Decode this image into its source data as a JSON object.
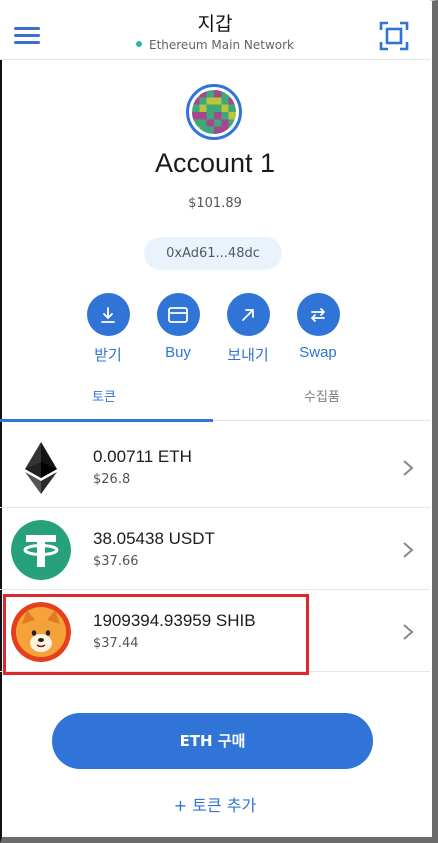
{
  "header": {
    "title": "지갑",
    "network": "Ethereum Main Network"
  },
  "account": {
    "name": "Account 1",
    "balance": "$101.89",
    "address": "0xAd61...48dc"
  },
  "actions": [
    {
      "label": "받기",
      "icon": "download-icon"
    },
    {
      "label": "Buy",
      "icon": "card-icon"
    },
    {
      "label": "보내기",
      "icon": "arrow-up-right-icon"
    },
    {
      "label": "Swap",
      "icon": "swap-icon"
    }
  ],
  "tabs": {
    "tokens": "토큰",
    "collectibles": "수집품"
  },
  "tokens": [
    {
      "amount": "0.00711 ETH",
      "fiat": "$26.8",
      "icon": "ethereum-icon"
    },
    {
      "amount": "38.05438 USDT",
      "fiat": "$37.66",
      "icon": "tether-icon"
    },
    {
      "amount": "1909394.93959 SHIB",
      "fiat": "$37.44",
      "icon": "shiba-inu-icon"
    }
  ],
  "buttons": {
    "buy_eth": "ETH 구매",
    "add_token": "+ 토큰 추가"
  },
  "colors": {
    "accent": "#2f74d6",
    "network_dot": "#29b6af",
    "highlight": "#e0262e",
    "usdt_green": "#26a17b",
    "shib_red": "#e63f1d"
  }
}
